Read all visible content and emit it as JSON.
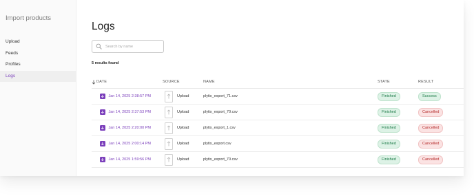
{
  "sidebar": {
    "title": "Import products",
    "items": [
      {
        "label": "Upload",
        "active": false
      },
      {
        "label": "Feeds",
        "active": false
      },
      {
        "label": "Profiles",
        "active": false
      },
      {
        "label": "Logs",
        "active": true
      }
    ]
  },
  "page": {
    "title": "Logs",
    "search_placeholder": "Search by name",
    "results_count": "5 results found"
  },
  "table": {
    "headers": {
      "date": "DATE",
      "source": "SOURCE",
      "name": "NAME",
      "state": "STATE",
      "result": "RESULT"
    },
    "rows": [
      {
        "date": "Jan 14, 2025 2:38:57 PM",
        "source": "Upload",
        "name": "plytix_export_71.csv",
        "state": "Finished",
        "result": "Success"
      },
      {
        "date": "Jan 14, 2025 2:37:53 PM",
        "source": "Upload",
        "name": "plytix_export_70.csv",
        "state": "Finished",
        "result": "Cancelled"
      },
      {
        "date": "Jan 14, 2025 2:20:00 PM",
        "source": "Upload",
        "name": "plytix_export_1.csv",
        "state": "Finished",
        "result": "Cancelled"
      },
      {
        "date": "Jan 14, 2025 2:00:14 PM",
        "source": "Upload",
        "name": "plytix_export.csv",
        "state": "Finished",
        "result": "Cancelled"
      },
      {
        "date": "Jan 14, 2025 1:59:56 PM",
        "source": "Upload",
        "name": "plytix_export_70.csv",
        "state": "Finished",
        "result": "Cancelled"
      }
    ]
  },
  "colors": {
    "accent": "#7b3fbb",
    "success_bg": "#ddf2e6",
    "success_text": "#1c7a47",
    "cancelled_bg": "#fbe3e3",
    "cancelled_text": "#b42a2a"
  },
  "icons": {
    "search": "search-icon",
    "sort": "arrow-down-icon",
    "date": "import-icon",
    "source": "upload-file-icon"
  }
}
